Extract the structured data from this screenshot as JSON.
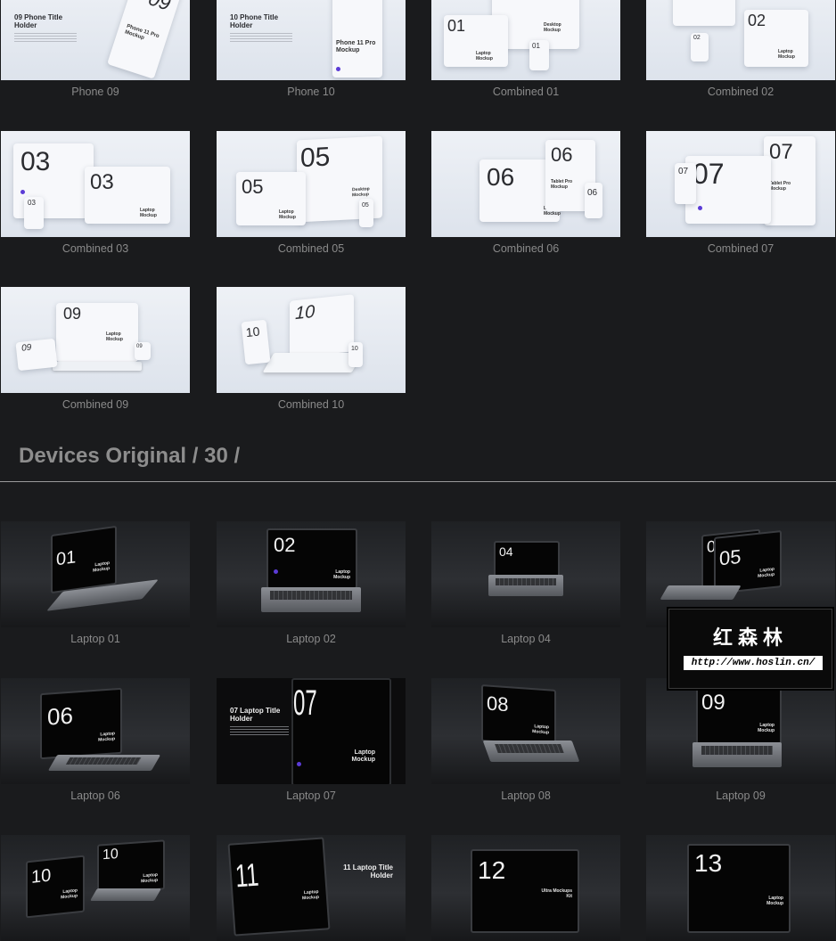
{
  "captions": {
    "phone09": "Phone 09",
    "phone10": "Phone 10",
    "comb01": "Combined 01",
    "comb02": "Combined 02",
    "comb03": "Combined 03",
    "comb05": "Combined 05",
    "comb06": "Combined 06",
    "comb07": "Combined 07",
    "comb09": "Combined 09",
    "comb10": "Combined 10",
    "lap01": "Laptop 01",
    "lap02": "Laptop 02",
    "lap04": "Laptop 04",
    "lap06": "Laptop 06",
    "lap07": "Laptop 07",
    "lap08": "Laptop 08",
    "lap09": "Laptop 09"
  },
  "section": {
    "title": "Devices Original / 30 /"
  },
  "thumbs": {
    "phone09_title": "09 Phone Title Holder",
    "phone10_title": "10 Phone Title Holder",
    "phone_mockup": "Phone 11 Pro Mockup",
    "c01": "01",
    "c02": "02",
    "c03": "03",
    "c05": "05",
    "c06": "06",
    "c07": "07",
    "c09": "09",
    "c10": "10",
    "desktop_mockup": "Desktop Mockup",
    "laptop_mockup": "Laptop Mockup",
    "tablet_mockup": "Tablet Pro Mockup",
    "l01": "01",
    "l02": "02",
    "l04": "04",
    "l05": "05",
    "l06": "06",
    "l07": "07",
    "l08": "08",
    "l09": "09",
    "l10": "10",
    "l11": "11",
    "l12": "12",
    "l13": "13",
    "lap07_title": "07 Laptop Title Holder",
    "lap11_title": "11 Laptop Title Holder",
    "ultra": "Ultra Mockups Kit"
  },
  "watermark": {
    "title": "红森林",
    "url": "http://www.hoslin.cn/"
  },
  "colors": {
    "accent": "#5b3bd6",
    "background": "#1a1b1d"
  }
}
